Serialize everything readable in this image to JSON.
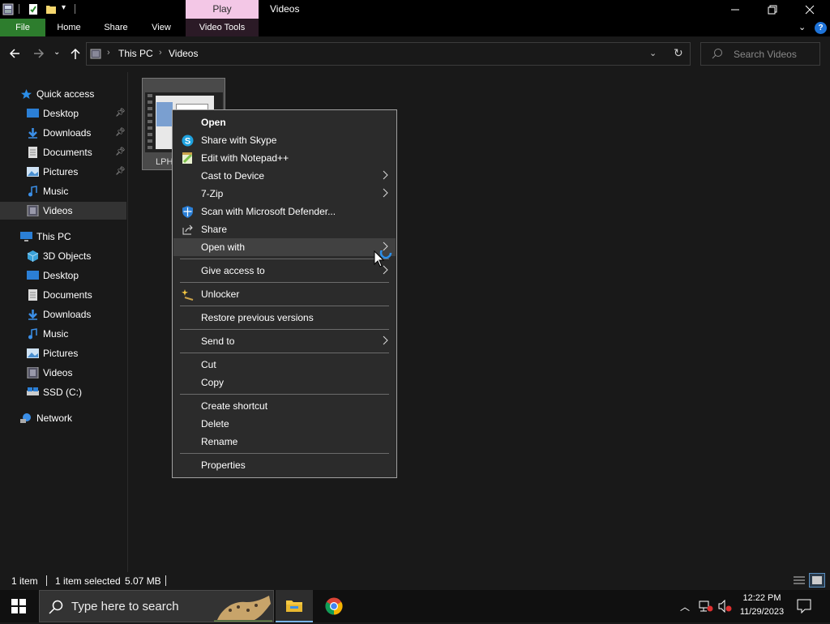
{
  "window": {
    "title": "Videos",
    "context_tab_header": "Play"
  },
  "ribbon": {
    "tabs": [
      "File",
      "Home",
      "Share",
      "View",
      "Video Tools"
    ]
  },
  "address": {
    "path": [
      "This PC",
      "Videos"
    ],
    "search_placeholder": "Search Videos"
  },
  "nav": {
    "quick_access": "Quick access",
    "quick_items": [
      {
        "label": "Desktop",
        "icon": "desktop-icon",
        "pinned": true
      },
      {
        "label": "Downloads",
        "icon": "downloads-icon",
        "pinned": true
      },
      {
        "label": "Documents",
        "icon": "documents-icon",
        "pinned": true
      },
      {
        "label": "Pictures",
        "icon": "pictures-icon",
        "pinned": true
      },
      {
        "label": "Music",
        "icon": "music-icon",
        "pinned": false
      },
      {
        "label": "Videos",
        "icon": "videos-icon",
        "pinned": false
      }
    ],
    "this_pc": "This PC",
    "pc_items": [
      {
        "label": "3D Objects",
        "icon": "3d-objects-icon"
      },
      {
        "label": "Desktop",
        "icon": "desktop-icon"
      },
      {
        "label": "Documents",
        "icon": "documents-icon"
      },
      {
        "label": "Downloads",
        "icon": "downloads-icon"
      },
      {
        "label": "Music",
        "icon": "music-icon"
      },
      {
        "label": "Pictures",
        "icon": "pictures-icon"
      },
      {
        "label": "Videos",
        "icon": "videos-icon"
      },
      {
        "label": "SSD (C:)",
        "icon": "drive-icon"
      }
    ],
    "network": "Network"
  },
  "file": {
    "name_visible": "LPH"
  },
  "context_menu": {
    "items": [
      {
        "label": "Open",
        "bold": true
      },
      {
        "label": "Share with Skype",
        "icon": "skype-icon"
      },
      {
        "label": "Edit with Notepad++",
        "icon": "notepadpp-icon"
      },
      {
        "label": "Cast to Device",
        "submenu": true
      },
      {
        "label": "7-Zip",
        "submenu": true
      },
      {
        "label": "Scan with Microsoft Defender...",
        "icon": "defender-shield-icon"
      },
      {
        "label": "Share",
        "icon": "share-icon"
      },
      {
        "label": "Open with",
        "submenu": true,
        "hover": true
      },
      {
        "label": "Give access to",
        "submenu": true
      },
      {
        "label": "Unlocker",
        "icon": "unlocker-wand-icon"
      },
      {
        "label": "Restore previous versions"
      },
      {
        "label": "Send to",
        "submenu": true
      },
      {
        "label": "Cut"
      },
      {
        "label": "Copy"
      },
      {
        "label": "Create shortcut"
      },
      {
        "label": "Delete"
      },
      {
        "label": "Rename"
      },
      {
        "label": "Properties"
      }
    ]
  },
  "status": {
    "item_count": "1 item",
    "selected": "1 item selected",
    "size": "5.07 MB"
  },
  "taskbar": {
    "search_placeholder": "Type here to search",
    "time": "12:22 PM",
    "date": "11/29/2023"
  },
  "colors": {
    "file_tab": "#2d7d2d",
    "context_tab": "#f3c7e6",
    "accent_blue": "#1e90ff"
  }
}
